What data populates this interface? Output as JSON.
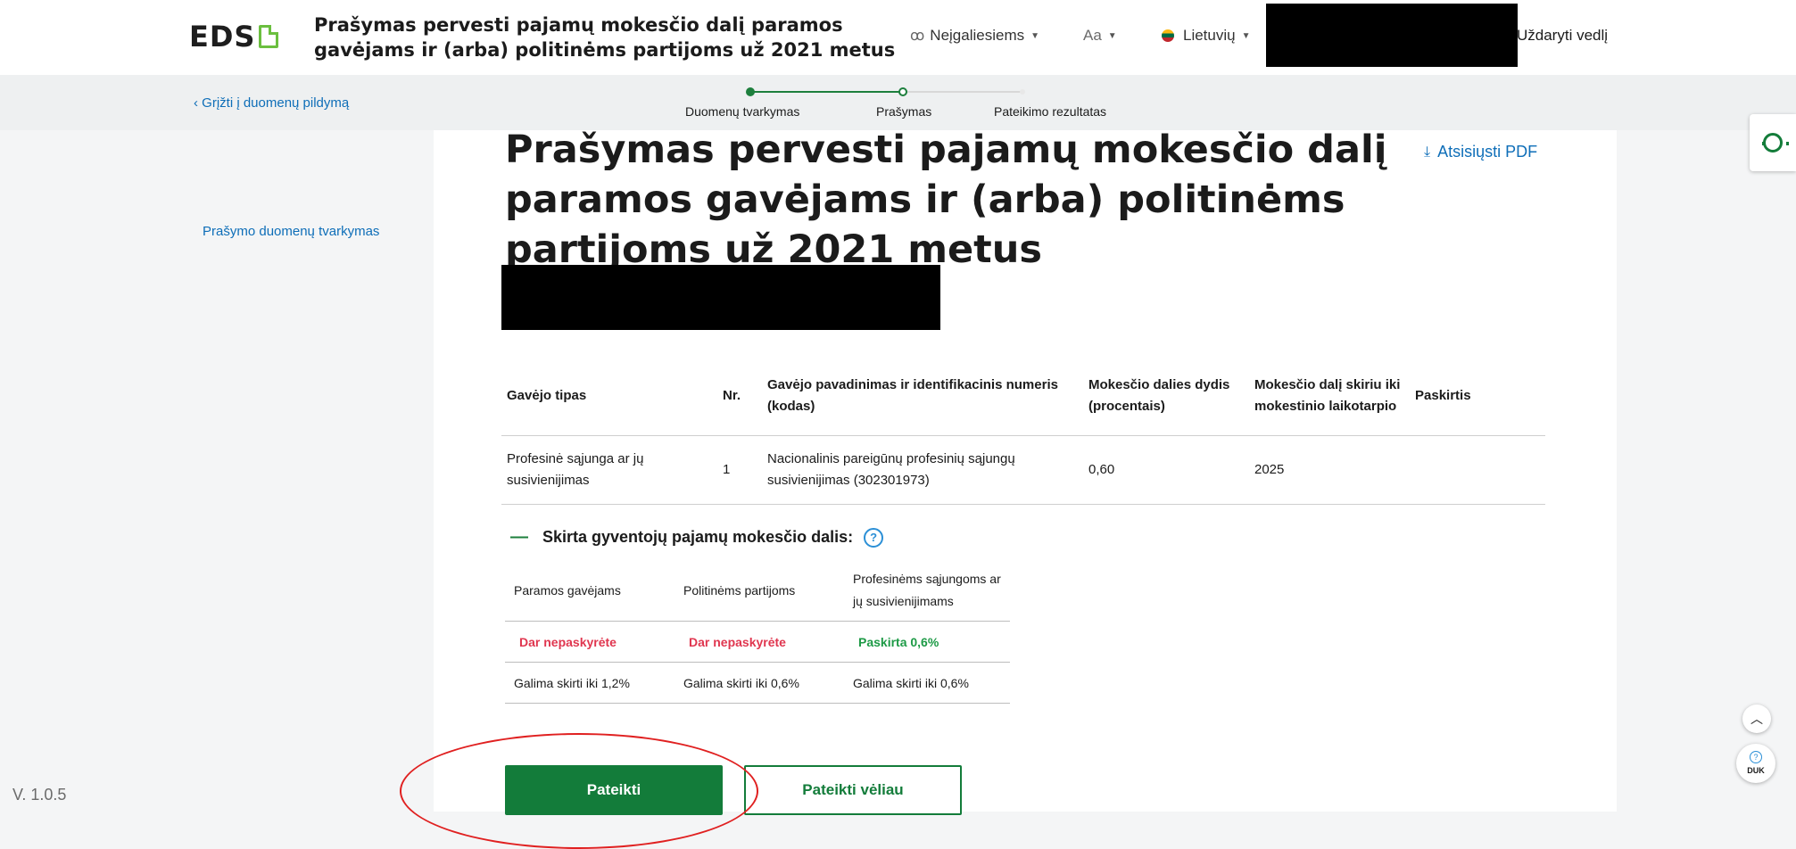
{
  "header": {
    "logo_text": "EDS",
    "title": "Prašymas pervesti pajamų mokesčio dalį paramos gavėjams ir (arba) politinėms partijoms už 2021 metus",
    "accessibility_label": "Neįgaliesiems",
    "font_size_label": "Aa",
    "language_label": "Lietuvių",
    "close_wizard_label": "Uždaryti vedlį"
  },
  "subbar": {
    "back_link": "Grįžti į duomenų pildymą",
    "steps": [
      {
        "label": "Duomenų tvarkymas",
        "status": "done"
      },
      {
        "label": "Prašymas",
        "status": "current"
      },
      {
        "label": "Pateikimo rezultatas",
        "status": "pending"
      }
    ]
  },
  "leftnav": {
    "items": [
      {
        "label": "Prašymo duomenų tvarkymas"
      }
    ],
    "version": "V. 1.0.5"
  },
  "main": {
    "title": "Prašymas pervesti pajamų mokesčio dalį paramos gavėjams ir (arba) politinėms partijoms už 2021 metus",
    "download_label": "Atsisiųsti PDF",
    "table": {
      "headers": [
        "Gavėjo tipas",
        "Nr.",
        "Gavėjo pavadinimas ir identifikacinis numeris (kodas)",
        "Mokesčio dalies dydis (procentais)",
        "Mokesčio dalį skiriu iki mokestinio laikotarpio",
        "Paskirtis"
      ],
      "rows": [
        {
          "type": "Profesinė sąjunga ar jų susivienijimas",
          "nr": "1",
          "name": "Nacionalinis pareigūnų profesinių sąjungų susivienijimas (302301973)",
          "percent": "0,60",
          "until": "2025",
          "purpose": ""
        }
      ]
    },
    "share": {
      "heading": "Skirta gyventojų pajamų mokesčio dalis:",
      "collapse_symbol": "—",
      "headers": [
        "Paramos gavėjams",
        "Politinėms partijoms",
        "Profesinėms sąjungoms ar jų susivienijimams"
      ],
      "status": [
        "Dar nepaskyrėte",
        "Dar nepaskyrėte",
        "Paskirta 0,6%"
      ],
      "limits": [
        "Galima skirti iki 1,2%",
        "Galima skirti iki 0,6%",
        "Galima skirti iki 0,6%"
      ]
    },
    "submit_label": "Pateikti",
    "submit_later_label": "Pateikti vėliau"
  },
  "floating": {
    "duk_label": "DUK"
  },
  "colors": {
    "primary_green": "#137c3a",
    "link_blue": "#0e6eb8",
    "warning_red": "#e0364f",
    "success_green": "#1d9a46",
    "annotation_red": "#e02020"
  }
}
